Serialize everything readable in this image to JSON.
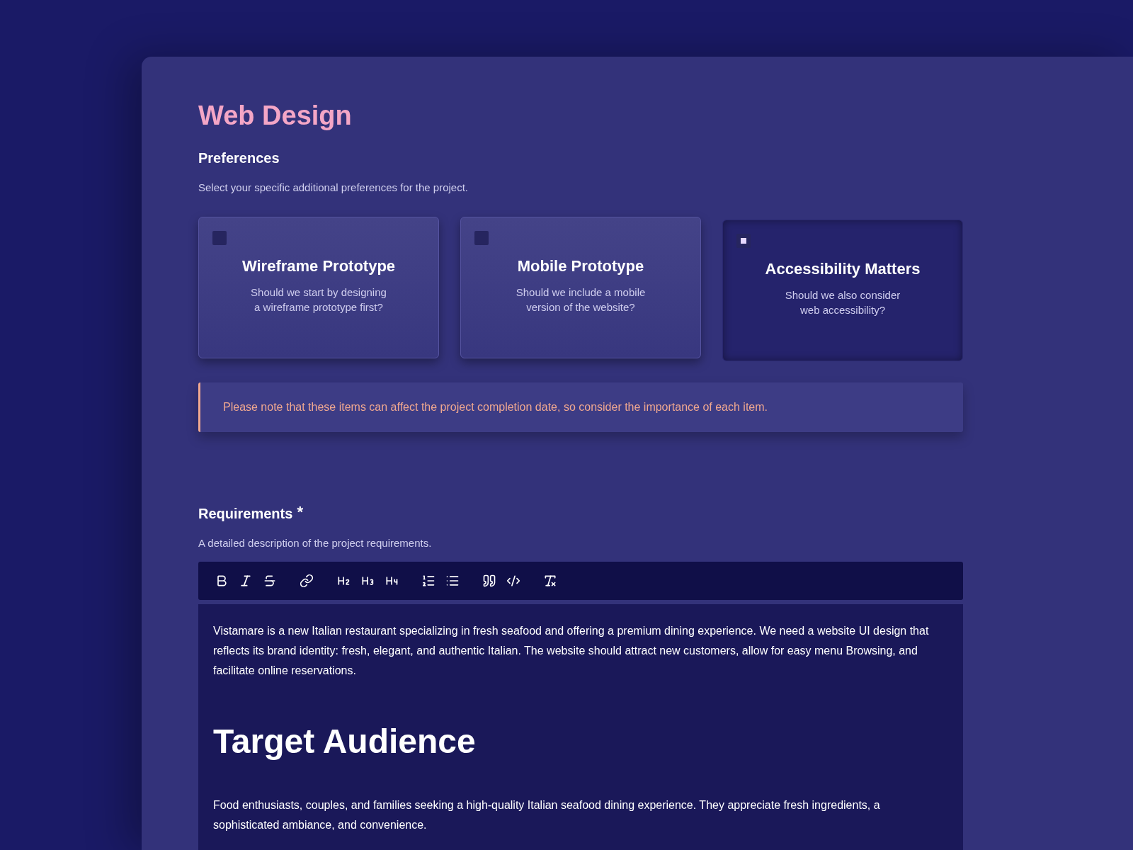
{
  "title": "Web Design",
  "preferences": {
    "heading": "Preferences",
    "description": "Select your specific additional preferences for the project.",
    "options": [
      {
        "title": "Wireframe Prototype",
        "lines": [
          "Should we start by designing",
          "a wireframe prototype first?"
        ],
        "checked": false
      },
      {
        "title": "Mobile Prototype",
        "lines": [
          "Should we include a mobile",
          "version of the website?"
        ],
        "checked": false
      },
      {
        "title": "Accessibility Matters",
        "lines": [
          "Should we also consider",
          "web accessibility?"
        ],
        "checked": true
      }
    ],
    "notice": "Please note that these items can affect the project completion date, so consider the importance of each item."
  },
  "requirements": {
    "heading": "Requirements",
    "required_mark": "*",
    "description": "A detailed description of the project requirements.",
    "toolbar": [
      {
        "kind": "bold"
      },
      {
        "kind": "italic"
      },
      {
        "kind": "strike"
      },
      {
        "kind": "sep"
      },
      {
        "kind": "link"
      },
      {
        "kind": "sep"
      },
      {
        "kind": "h2"
      },
      {
        "kind": "h3"
      },
      {
        "kind": "h4"
      },
      {
        "kind": "sep"
      },
      {
        "kind": "ol"
      },
      {
        "kind": "ul"
      },
      {
        "kind": "sep"
      },
      {
        "kind": "quote"
      },
      {
        "kind": "code"
      },
      {
        "kind": "sep"
      },
      {
        "kind": "clear"
      }
    ],
    "content": [
      {
        "kind": "paragraph",
        "text": "Vistamare is a new Italian restaurant specializing in fresh seafood and offering a premium dining experience. We need a website UI design that reflects its brand identity: fresh, elegant, and authentic Italian. The website should attract new customers, allow for easy menu Browsing, and facilitate online reservations."
      },
      {
        "kind": "heading",
        "text": "Target Audience"
      },
      {
        "kind": "paragraph",
        "text": "Food enthusiasts, couples, and families seeking a high-quality Italian seafood dining experience. They appreciate fresh ingredients, a sophisticated ambiance, and convenience."
      }
    ]
  }
}
